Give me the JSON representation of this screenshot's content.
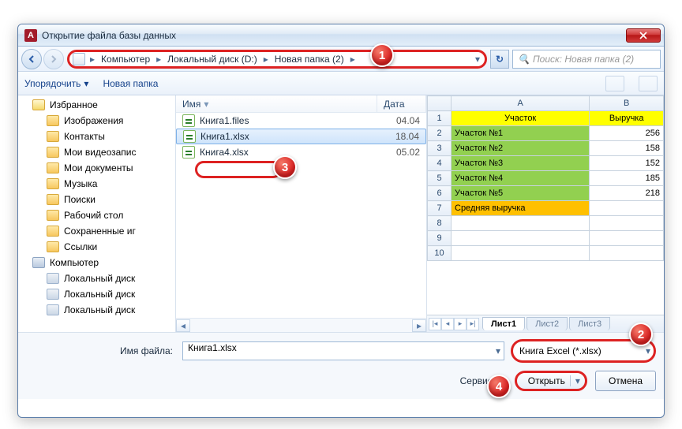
{
  "window": {
    "title": "Открытие файла базы данных"
  },
  "breadcrumbs": {
    "seg1": "Компьютер",
    "seg2": "Локальный диск (D:)",
    "seg3": "Новая папка (2)"
  },
  "search": {
    "placeholder": "Поиск: Новая папка (2)"
  },
  "toolbar": {
    "organize": "Упорядочить",
    "newfolder": "Новая папка"
  },
  "sidebar": {
    "fav": "Избранное",
    "items": {
      "pics": "Изображения",
      "contacts": "Контакты",
      "videos": "Мои видеозапис",
      "docs": "Мои документы",
      "music": "Музыка",
      "searches": "Поиски",
      "desktop": "Рабочий стол",
      "saved": "Сохраненные иг",
      "links": "Ссылки",
      "computer": "Компьютер",
      "d1": "Локальный диск",
      "d2": "Локальный диск",
      "d3": "Локальный диск"
    }
  },
  "filelist": {
    "col_name": "Имя",
    "col_date": "Дата",
    "r1": {
      "name": "Книга1.files",
      "date": "04.04"
    },
    "r2": {
      "name": "Книга1.xlsx",
      "date": "18.04"
    },
    "r3": {
      "name": "Книга4.xlsx",
      "date": "05.02"
    }
  },
  "chart_data": {
    "type": "table",
    "columns": {
      "A": "Участок",
      "B": "Выручка"
    },
    "rows": [
      {
        "a": "Участок №1",
        "b": "256"
      },
      {
        "a": "Участок №2",
        "b": "158"
      },
      {
        "a": "Участок №3",
        "b": "152"
      },
      {
        "a": "Участок №4",
        "b": "185"
      },
      {
        "a": "Участок №5",
        "b": "218"
      },
      {
        "a": "Средняя выручка",
        "b": ""
      }
    ]
  },
  "sheets": {
    "s1": "Лист1",
    "s2": "Лист2",
    "s3": "Лист3"
  },
  "footer": {
    "filename_label": "Имя файла:",
    "filename_value": "Книга1.xlsx",
    "filetype": "Книга Excel (*.xlsx)",
    "service": "Сервис",
    "open": "Открыть",
    "cancel": "Отмена"
  },
  "callouts": {
    "c1": "1",
    "c2": "2",
    "c3": "3",
    "c4": "4"
  }
}
